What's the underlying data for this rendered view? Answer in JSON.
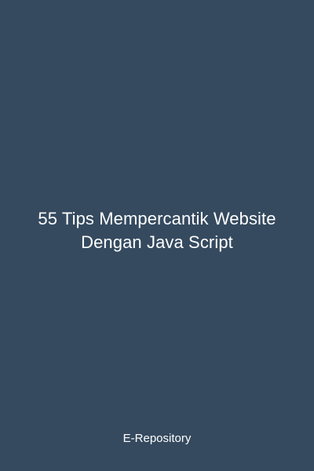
{
  "cover": {
    "title_lines": [
      "55 Tips Mempercantik Website",
      "Dengan Java Script"
    ],
    "publisher": "E-Repository",
    "colors": {
      "background": "#354a5f",
      "text": "#ffffff"
    }
  }
}
